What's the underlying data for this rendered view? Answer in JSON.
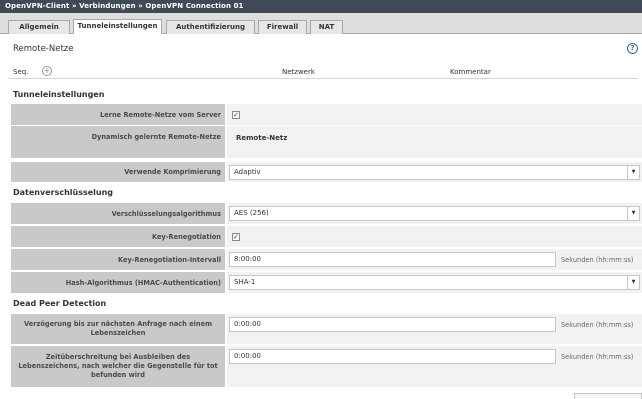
{
  "breadcrumb": "OpenVPN-Client » Verbindungen » OpenVPN Connection 01",
  "tabs": [
    "Allgemein",
    "Tunneleinstellungen",
    "Authentifizierung",
    "Firewall",
    "NAT"
  ],
  "remote": {
    "title": "Remote-Netze",
    "help": "?",
    "seq": "Seq.",
    "add": "+",
    "network": "Netzwerk",
    "comment": "Kommentar"
  },
  "tunnel": {
    "title": "Tunneleinstellungen",
    "learn_label": "Lerne Remote-Netze vom Server",
    "dyn_label": "Dynamisch gelernte Remote-Netze",
    "dyn_value": "Remote-Netz",
    "comp_label": "Verwende Komprimierung",
    "comp_value": "Adaptiv"
  },
  "crypto": {
    "title": "Datenverschlüsselung",
    "algo_label": "Verschlüsselungsalgorithmus",
    "algo_value": "AES (256)",
    "reneg_label": "Key-Renegotiation",
    "interval_label": "Key-Renegotiation-Intervall",
    "interval_value": "8:00:00",
    "interval_unit": "Sekunden (hh:mm:ss)",
    "hash_label": "Hash-Algorithmus (HMAC-Authentication)",
    "hash_value": "SHA-1"
  },
  "dpd": {
    "title": "Dead Peer Detection",
    "delay_label": "Verzögerung bis zur nächsten Anfrage nach einem Lebenszeichen",
    "delay_value": "0:00:00",
    "delay_unit": "Sekunden (hh:mm:ss)",
    "timeout_label": "Zeitüberschreitung bei Ausbleiben des Lebenszeichens, nach welcher die Gegenstelle für tot befunden wird",
    "timeout_value": "0:00:00",
    "timeout_unit": "Sekunden (hh:mm:ss)"
  },
  "icons": {
    "check": "✓",
    "dropdown": "▼"
  }
}
